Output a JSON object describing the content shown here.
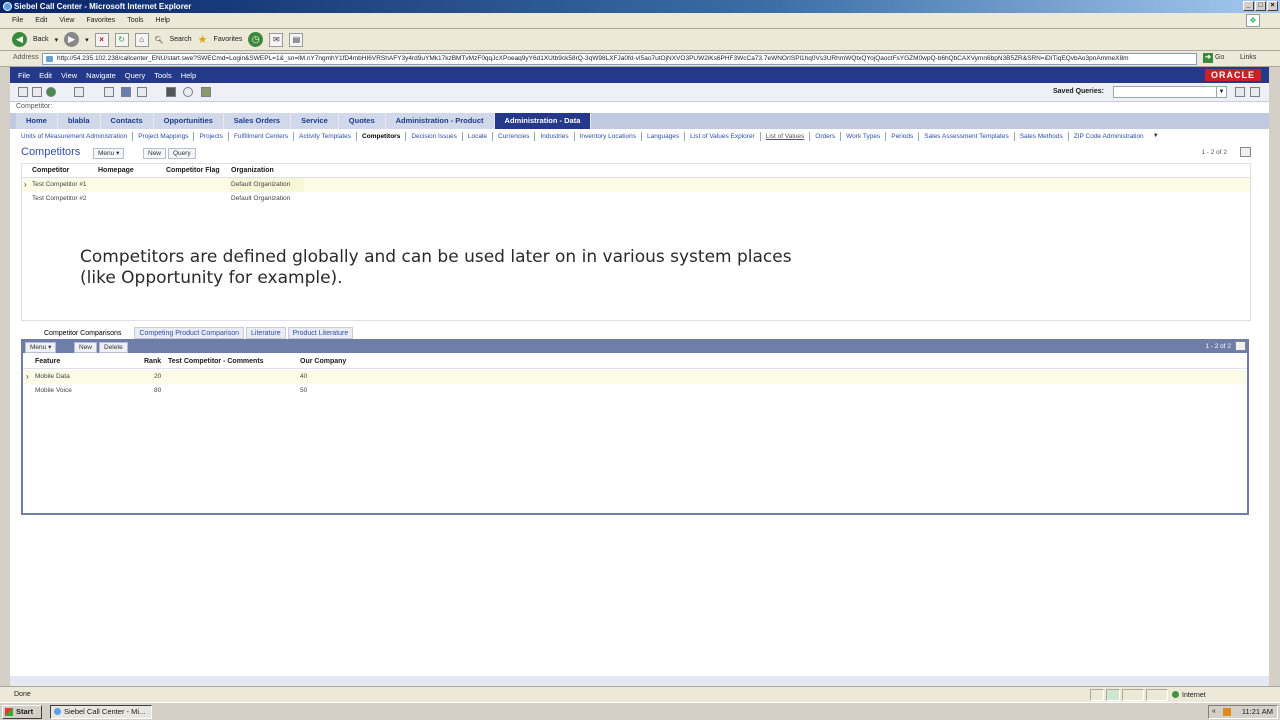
{
  "window": {
    "title": "Siebel Call Center - Microsoft Internet Explorer"
  },
  "ie_menu": [
    "File",
    "Edit",
    "View",
    "Favorites",
    "Tools",
    "Help"
  ],
  "ie_toolbar": {
    "back": "Back",
    "search": "Search",
    "favorites": "Favorites"
  },
  "address": {
    "label": "Address",
    "url": "http://54.235.102.238/callcenter_ENU/start.swe?SWECmd=Login&SWEPL=1&_sn=lM.nY7ngmhY1fD4mbHI6VRShAFY3y4rd9uYMk17kzBMTvMzF0qqJcXPoeaq9yY6d1XUtb9ck58rQ-3qW98LXFJa0fd-vI5ao7utOjNXVO3PUW2iKs6PHF3WcCa73.7eWNOrISPl1hq0Vs3URhmWQtxQYojQaoctFsYGZM0wpQ-b6hQbCAXVymn6bpN3B5ZR&SRN=iDITiqEQvbAo3pnAmmeX8m",
    "go": "Go",
    "links": "Links"
  },
  "siebel_menu": [
    "File",
    "Edit",
    "View",
    "Navigate",
    "Query",
    "Tools",
    "Help"
  ],
  "brand": "ORACLE",
  "saved_queries_label": "Saved Queries:",
  "breadcrumb": "Competitor:",
  "screen_tabs": [
    {
      "label": "Home",
      "active": false
    },
    {
      "label": "blabla",
      "active": false
    },
    {
      "label": "Contacts",
      "active": false
    },
    {
      "label": "Opportunities",
      "active": false
    },
    {
      "label": "Sales Orders",
      "active": false
    },
    {
      "label": "Service",
      "active": false
    },
    {
      "label": "Quotes",
      "active": false
    },
    {
      "label": "Administration - Product",
      "active": false
    },
    {
      "label": "Administration - Data",
      "active": true
    }
  ],
  "view_tabs": [
    "Units of Measurement Administration",
    "Project Mappings",
    "Projects",
    "Fulfillment Centers",
    "Activity Templates",
    "Competitors",
    "Decision Issues",
    "Locale",
    "Currencies",
    "Industries",
    "Inventory Locations",
    "Languages",
    "List of Values Explorer",
    "List of Values",
    "Orders",
    "Work Types",
    "Periods",
    "Sales Assessment Templates",
    "Sales Methods",
    "ZIP Code Administration"
  ],
  "competitors_applet": {
    "title": "Competitors",
    "menu": "Menu ▾",
    "new": "New",
    "query": "Query",
    "record_count": "1 - 2 of 2",
    "columns": [
      "Competitor",
      "Homepage",
      "Competitor Flag",
      "Organization"
    ],
    "rows": [
      {
        "competitor": "Test Competitor #1",
        "homepage": "",
        "flag": "",
        "organization": "Default Organization",
        "selected": true
      },
      {
        "competitor": "Test Competitor #2",
        "homepage": "",
        "flag": "",
        "organization": "Default Organization",
        "selected": false
      }
    ]
  },
  "overlay": {
    "line1": "Competitors are defined globally and can be used later on in various system places",
    "line2": "(like Opportunity for example)."
  },
  "lower_tabs": [
    {
      "label": "Competitor Comparisons",
      "active": true
    },
    {
      "label": "Competing Product Comparison",
      "active": false
    },
    {
      "label": "Literature",
      "active": false
    },
    {
      "label": "Product Literature",
      "active": false
    }
  ],
  "comparisons_applet": {
    "menu": "Menu ▾",
    "new": "New",
    "delete": "Delete",
    "record_count": "1 - 2 of 2",
    "columns": [
      "Feature",
      "Rank",
      "Test Competitor - Comments",
      "Our Company"
    ],
    "rows": [
      {
        "feature": "Mobile Data",
        "rank": "20",
        "comments": "",
        "our_company": "40",
        "selected": true
      },
      {
        "feature": "Mobile Voice",
        "rank": "80",
        "comments": "",
        "our_company": "50",
        "selected": false
      }
    ]
  },
  "status": {
    "text": "Done",
    "zone": "Internet"
  },
  "taskbar": {
    "start": "Start",
    "item": "Siebel Call Center - Mi...",
    "clock": "11:21 AM"
  },
  "colors": {
    "siebel_blue": "#25398a",
    "oracle_red": "#cc2026",
    "link_blue": "#2d4fae",
    "row_highlight": "#fbfbe6"
  }
}
